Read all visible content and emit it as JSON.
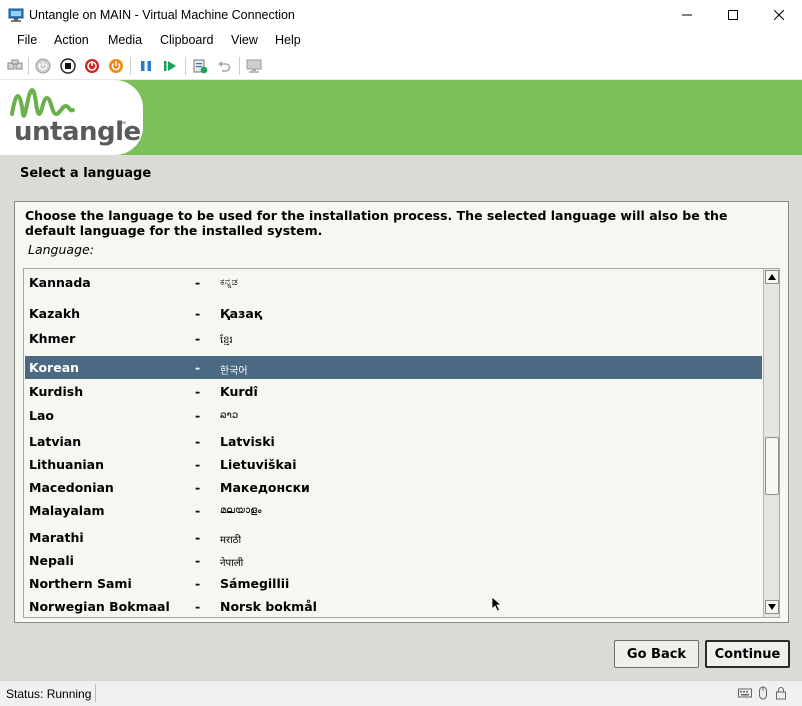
{
  "window": {
    "title": "Untangle on MAIN - Virtual Machine Connection",
    "controls": [
      "minimize",
      "maximize",
      "close"
    ]
  },
  "menu": {
    "items": [
      "File",
      "Action",
      "Media",
      "Clipboard",
      "View",
      "Help"
    ]
  },
  "toolbar": {
    "icons": [
      "ctrl-alt-del-icon",
      "start-icon",
      "turn-off-icon",
      "shutdown-icon",
      "save-icon",
      "pause-icon",
      "resume-icon",
      "checkpoint-icon",
      "revert-icon",
      "enhanced-session-icon"
    ]
  },
  "installer": {
    "logo_text": "untangle",
    "logo_tm": "™",
    "section_title": "Select a language",
    "instruction": "Choose the language to be used for the installation process. The selected language will also be the default language for the installed system.",
    "language_label": "Language:",
    "languages": [
      {
        "name": "Kannada",
        "dash": "-",
        "native": "ಕನ್ನಡ"
      },
      {
        "name": "Kazakh",
        "dash": "-",
        "native": "Қазақ"
      },
      {
        "name": "Khmer",
        "dash": "-",
        "native": "ខ្មែរ"
      },
      {
        "name": "Korean",
        "dash": "-",
        "native": "한국어"
      },
      {
        "name": "Kurdish",
        "dash": "-",
        "native": "Kurdî"
      },
      {
        "name": "Lao",
        "dash": "-",
        "native": "ລາວ"
      },
      {
        "name": "Latvian",
        "dash": "-",
        "native": "Latviski"
      },
      {
        "name": "Lithuanian",
        "dash": "-",
        "native": "Lietuviškai"
      },
      {
        "name": "Macedonian",
        "dash": "-",
        "native": "Македонски"
      },
      {
        "name": "Malayalam",
        "dash": "-",
        "native": "മലയാളം"
      },
      {
        "name": "Marathi",
        "dash": "-",
        "native": "मराठी"
      },
      {
        "name": "Nepali",
        "dash": "-",
        "native": "नेपाली"
      },
      {
        "name": "Northern Sami",
        "dash": "-",
        "native": "Sámegillii"
      },
      {
        "name": "Norwegian Bokmaal",
        "dash": "-",
        "native": "Norsk bokmål"
      }
    ],
    "selected_language": "Korean",
    "buttons": {
      "back": "Go Back",
      "continue": "Continue"
    },
    "colors": {
      "banner": "#7cc05a",
      "selection": "#4b6983",
      "background": "#dcdad5"
    }
  },
  "status": {
    "text": "Status: Running"
  }
}
